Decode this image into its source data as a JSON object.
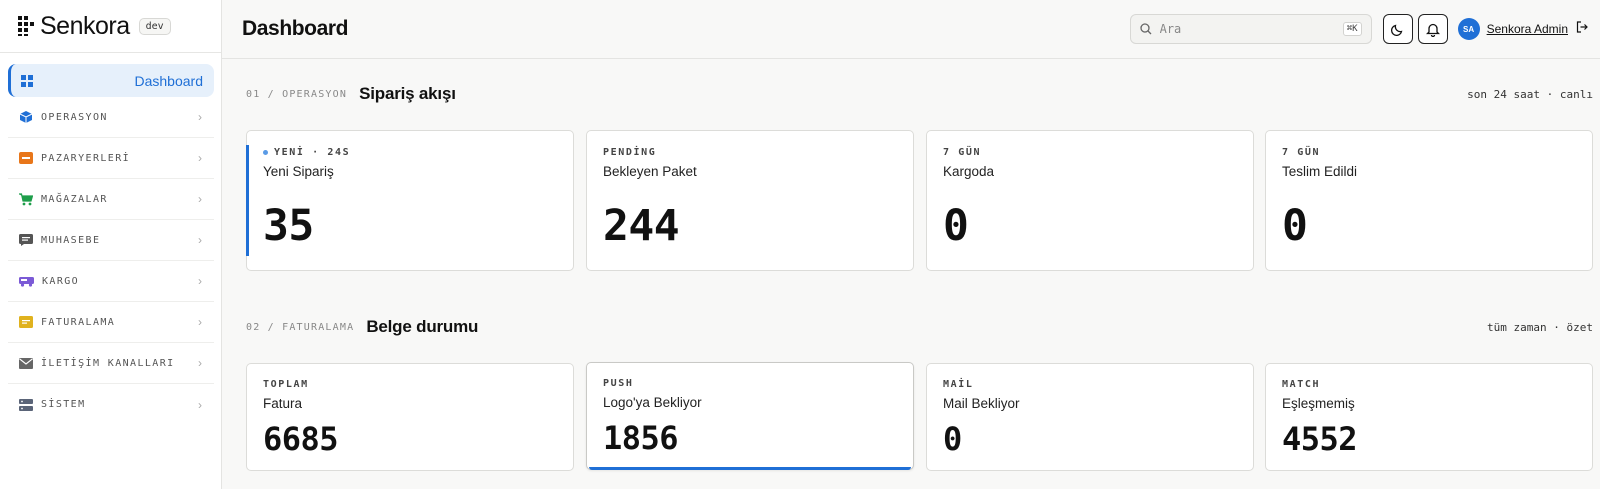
{
  "brand": {
    "name": "Senkora",
    "env": "dev"
  },
  "sidebar": {
    "active": {
      "label": "Dashboard"
    },
    "items": [
      {
        "label": "OPERASYON",
        "icon": "package-icon",
        "color": "#1f6fd6"
      },
      {
        "label": "PAZARYERLERİ",
        "icon": "store-icon",
        "color": "#e8761a"
      },
      {
        "label": "MAĞAZALAR",
        "icon": "cart-icon",
        "color": "#1e9e4a"
      },
      {
        "label": "MUHASEBE",
        "icon": "message-icon",
        "color": "#555555"
      },
      {
        "label": "KARGO",
        "icon": "truck-icon",
        "color": "#7b5ad6"
      },
      {
        "label": "FATURALAMA",
        "icon": "receipt-icon",
        "color": "#e0b21e"
      },
      {
        "label": "İLETİŞİM KANALLARI",
        "icon": "mail-icon",
        "color": "#666666"
      },
      {
        "label": "SİSTEM",
        "icon": "server-icon",
        "color": "#5a6478"
      }
    ]
  },
  "header": {
    "title": "Dashboard",
    "search_placeholder": "Ara",
    "search_shortcut": "⌘K",
    "user_initials": "SA",
    "user_name": "Senkora Admin"
  },
  "sections": [
    {
      "number": "01 / OPERASYON",
      "title": "Sipariş akışı",
      "meta": "son 24 saat · canlı",
      "cards": [
        {
          "tag": "YENİ · 24S",
          "label": "Yeni Sipariş",
          "value": "35"
        },
        {
          "tag": "PENDİNG",
          "label": "Bekleyen Paket",
          "value": "244"
        },
        {
          "tag": "7 GÜN",
          "label": "Kargoda",
          "value": "0"
        },
        {
          "tag": "7 GÜN",
          "label": "Teslim Edildi",
          "value": "0"
        }
      ]
    },
    {
      "number": "02 / FATURALAMA",
      "title": "Belge durumu",
      "meta": "tüm zaman · özet",
      "cards": [
        {
          "tag": "TOPLAM",
          "label": "Fatura",
          "value": "6685"
        },
        {
          "tag": "PUSH",
          "label": "Logo'ya Bekliyor",
          "value": "1856"
        },
        {
          "tag": "MAİL",
          "label": "Mail Bekliyor",
          "value": "0"
        },
        {
          "tag": "MATCH",
          "label": "Eşleşmemiş",
          "value": "4552"
        }
      ]
    }
  ],
  "colors": {
    "accent": "#1f6fd6",
    "background": "#f8f8f7"
  }
}
